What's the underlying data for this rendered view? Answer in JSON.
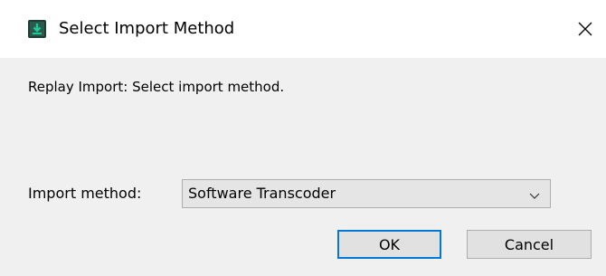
{
  "window": {
    "title": "Select Import Method",
    "icon": "app-download-icon",
    "close_icon": "close-icon"
  },
  "message": "Replay Import: Select import method.",
  "import_method": {
    "label": "Import method:",
    "selected": "Software Transcoder"
  },
  "buttons": {
    "ok": "OK",
    "cancel": "Cancel"
  },
  "colors": {
    "dialog_bg": "#f0f0f0",
    "titlebar_bg": "#ffffff",
    "default_button_border": "#0078d7",
    "icon_bg": "#1f3f36",
    "icon_accent": "#20c997"
  }
}
